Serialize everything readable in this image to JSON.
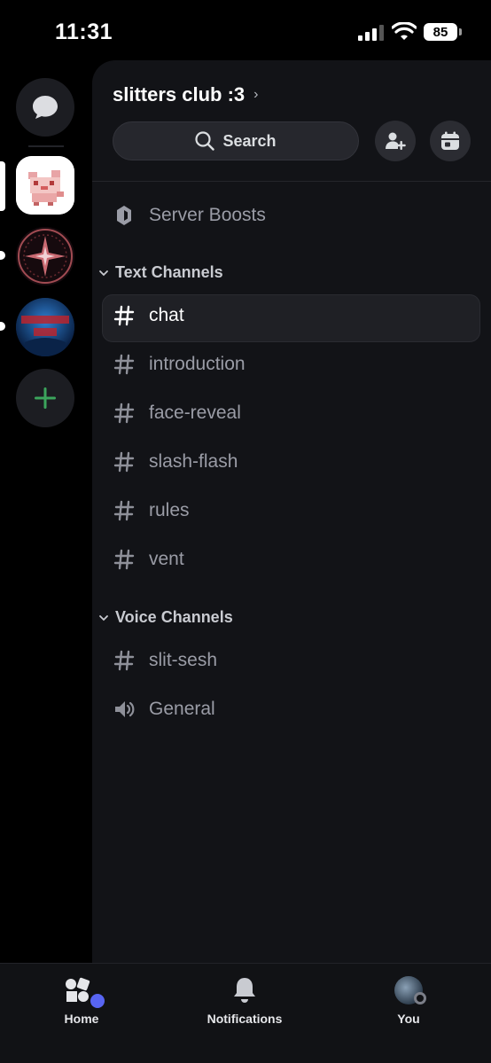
{
  "status_bar": {
    "time": "11:31",
    "battery": "85"
  },
  "server_header": {
    "name": "slitters club :3"
  },
  "search": {
    "label": "Search"
  },
  "server_boosts": {
    "label": "Server Boosts"
  },
  "sections": {
    "text": {
      "label": "Text Channels"
    },
    "voice": {
      "label": "Voice Channels"
    }
  },
  "text_channels": [
    "chat",
    "introduction",
    "face-reveal",
    "slash-flash",
    "rules",
    "vent"
  ],
  "voice_channels": [
    "slit-sesh",
    "General"
  ],
  "bottom_nav": {
    "home": "Home",
    "notifications": "Notifications",
    "you": "You"
  },
  "colors": {
    "accent": "#5865f2",
    "add_green": "#3ba55c",
    "panel_bg": "#121317"
  },
  "icons": [
    "chat-bubble-icon",
    "search-icon",
    "add-member-icon",
    "calendar-icon",
    "boost-gem-icon",
    "hash-icon",
    "speaker-icon",
    "chevron-down-icon",
    "home-icon",
    "bell-icon",
    "plus-icon"
  ]
}
